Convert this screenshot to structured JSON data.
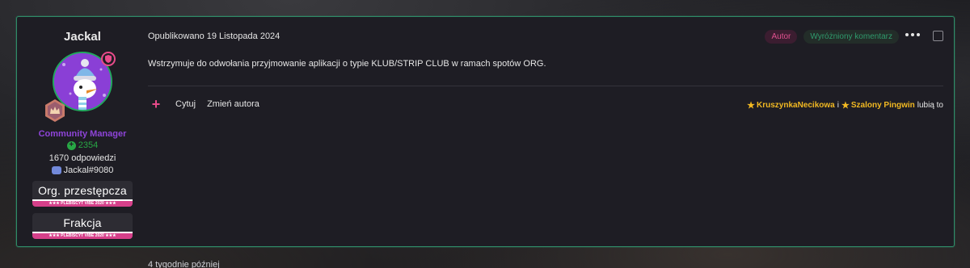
{
  "author": {
    "name": "Jackal",
    "role": "Community Manager",
    "reputation": "2354",
    "replies": "1670 odpowiedzi",
    "discord": "Jackal#9080",
    "awards": [
      {
        "title": "Org. przestępcza",
        "strip": "★★★ PLEBISCYT VIBE 2020 ★★★"
      },
      {
        "title": "Frakcja",
        "strip": "★★★ PLEBISCYT VIBE 2020 ★★★"
      }
    ]
  },
  "post": {
    "meta": "Opublikowano 19 Listopada 2024",
    "badge_author": "Autor",
    "badge_highlight": "Wyróżniony komentarz",
    "body": "Wstrzymuje do odwołania przyjmowanie aplikacji o typie KLUB/STRIP CLUB w ramach spotów ORG.",
    "actions": {
      "quote": "Cytuj",
      "change_author": "Zmień autora"
    },
    "likes": {
      "user1": "KruszynkaNecikowa",
      "separator": "i",
      "user2": "Szalony Pingwin",
      "suffix": "lubią to"
    }
  },
  "below_text": "4 tygodnie później",
  "colors": {
    "accent_border": "#2f8c68",
    "role": "#8e44d8",
    "reputation": "#28a745",
    "author_badge": "#e0508f",
    "like_user": "#f2b922"
  }
}
